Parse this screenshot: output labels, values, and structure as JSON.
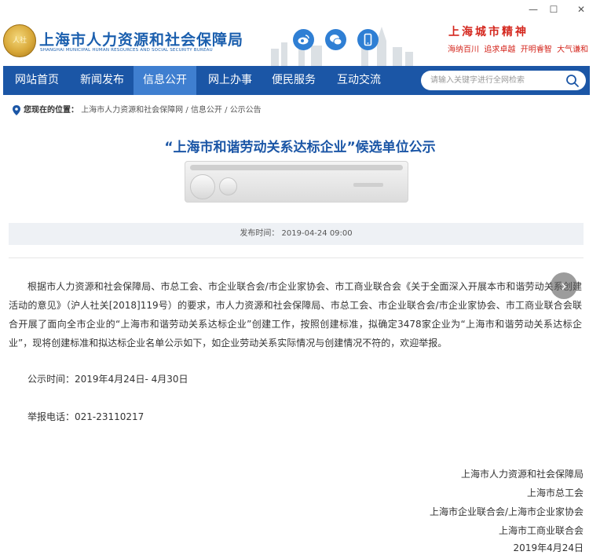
{
  "window": {
    "minimize": "—",
    "maximize": "☐",
    "close": "✕"
  },
  "header": {
    "logo_text": "上海市人力资源和社会保障局",
    "logo_en": "SHANGHAI MUNICIPAL HUMAN RESOURCES AND SOCIAL SECURITY BUREAU",
    "emblem_text": "人社",
    "social_icons": [
      "weibo-icon",
      "wechat-icon",
      "mobile-icon"
    ],
    "spirit_title": "上海城市精神",
    "spirit_tags": [
      "海纳百川",
      "追求卓越",
      "开明睿智",
      "大气谦和"
    ]
  },
  "nav": {
    "items": [
      {
        "label": "网站首页",
        "active": false
      },
      {
        "label": "新闻发布",
        "active": false
      },
      {
        "label": "信息公开",
        "active": true
      },
      {
        "label": "网上办事",
        "active": false
      },
      {
        "label": "便民服务",
        "active": false
      },
      {
        "label": "互动交流",
        "active": false
      }
    ],
    "search_placeholder": "请输入关键字进行全网检索"
  },
  "breadcrumb": {
    "prefix": "您现在的位置：",
    "items": [
      "上海市人力资源和社会保障网",
      "信息公开",
      "公示公告"
    ],
    "separator": "/"
  },
  "article": {
    "title": "“上海市和谐劳动关系达标企业”候选单位公示",
    "publish_time": "发布时间： 2019-04-24 09:00",
    "paragraph": "根据市人力资源和社会保障局、市总工会、市企业联合会/市企业家协会、市工商业联合会《关于全面深入开展本市和谐劳动关系创建活动的意见》（沪人社关[2018]119号）的要求，市人力资源和社会保障局、市总工会、市企业联合会/市企业家协会、市工商业联合会联合开展了面向全市企业的“上海市和谐劳动关系达标企业”创建工作，按照创建标准，拟确定3478家企业为“上海市和谐劳动关系达标企业”，现将创建标准和拟达标企业名单公示如下，如企业劳动关系实际情况与创建情况不符的，欢迎举报。",
    "period": "公示时间：2019年4月24日- 4月30日",
    "phone": "举报电话：021-23110217",
    "signatures": [
      "上海市人力资源和社会保障局",
      "上海市总工会",
      "上海市企业联合会/上海市企业家协会",
      "上海市工商业联合会",
      "2019年4月24日"
    ]
  },
  "colors": {
    "nav_bg": "#1b56a6",
    "nav_active": "#3f7fd0",
    "title_blue": "#1b56a6",
    "spirit_red": "#d4261d"
  }
}
